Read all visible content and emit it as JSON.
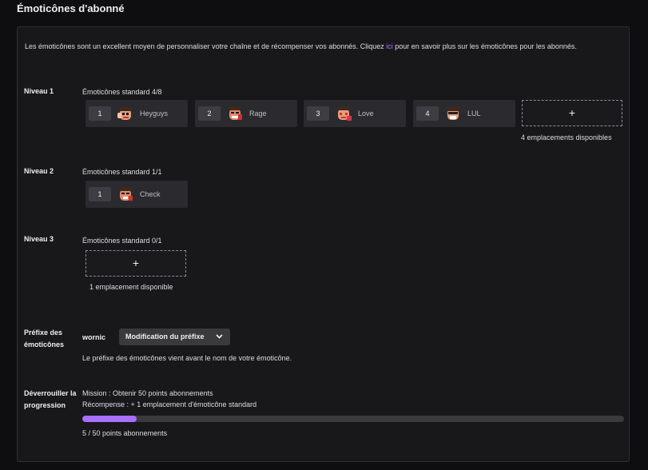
{
  "page_title": "Émoticônes d'abonné",
  "intro": {
    "text_before": "Les émoticônes sont un excellent moyen de personnaliser votre chaîne et de récompenser vos abonnés. Cliquez ",
    "link": "ici",
    "text_after": " pour en savoir plus sur les émoticônes pour les abonnés."
  },
  "tiers": [
    {
      "label": "Niveau 1",
      "slots_label": "Émoticônes standard 4/8",
      "emotes": [
        {
          "num": "1",
          "name": "Heyguys",
          "icon": "heyguys-emote-icon"
        },
        {
          "num": "2",
          "name": "Rage",
          "icon": "rage-emote-icon"
        },
        {
          "num": "3",
          "name": "Love",
          "icon": "love-emote-icon"
        },
        {
          "num": "4",
          "name": "LUL",
          "icon": "lul-emote-icon"
        }
      ],
      "add_label": "+",
      "available": "4 emplacements disponibles"
    },
    {
      "label": "Niveau 2",
      "slots_label": "Émoticônes standard 1/1",
      "emotes": [
        {
          "num": "1",
          "name": "Check",
          "icon": "check-emote-icon"
        }
      ]
    },
    {
      "label": "Niveau 3",
      "slots_label": "Émoticônes standard 0/1",
      "emotes": [],
      "add_label": "+",
      "available": "1 emplacement disponible"
    }
  ],
  "prefix": {
    "label_line1": "Préfixe des",
    "label_line2": "émoticônes",
    "value": "wornic",
    "button_label": "Modification du préfixe",
    "description": "Le préfixe des émoticônes vient avant le nom de votre émoticône."
  },
  "progression": {
    "label_line1": "Déverrouiller la",
    "label_line2": "progression",
    "mission": "Mission : Obtenir 50 points abonnements",
    "reward": "Récompense : + 1 emplacement d'émoticône standard",
    "progress_fraction": 0.1,
    "progress_text": "5 / 50 points abonnements"
  },
  "colors": {
    "accent": "#a970ff",
    "background": "#0e0e10",
    "panel": "#18181b"
  }
}
